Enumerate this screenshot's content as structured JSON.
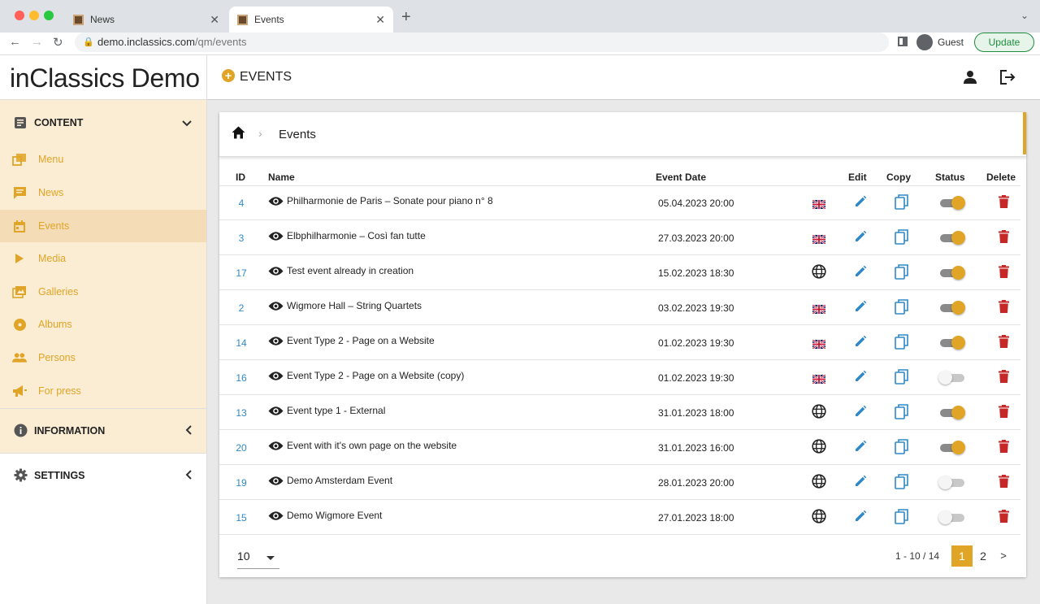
{
  "browser": {
    "tabs": [
      {
        "title": "News",
        "active": false
      },
      {
        "title": "Events",
        "active": true
      }
    ],
    "url_host": "demo.inclassics.com",
    "url_path": "/qm/events",
    "profile": "Guest",
    "update_label": "Update"
  },
  "sidebar": {
    "brand": "inClassics Demo",
    "content_label": "CONTENT",
    "items": [
      {
        "label": "Menu",
        "icon": "menu-stack-icon"
      },
      {
        "label": "News",
        "icon": "chat-icon"
      },
      {
        "label": "Events",
        "icon": "calendar-icon"
      },
      {
        "label": "Media",
        "icon": "play-icon"
      },
      {
        "label": "Galleries",
        "icon": "gallery-icon"
      },
      {
        "label": "Albums",
        "icon": "album-icon"
      },
      {
        "label": "Persons",
        "icon": "people-icon"
      },
      {
        "label": "For press",
        "icon": "megaphone-icon"
      }
    ],
    "active_item": "Events",
    "information_label": "INFORMATION",
    "settings_label": "SETTINGS"
  },
  "header": {
    "title": "EVENTS"
  },
  "breadcrumb": {
    "current": "Events"
  },
  "table": {
    "columns": [
      "ID",
      "Name",
      "Event Date",
      "Edit",
      "Copy",
      "Status",
      "Delete"
    ],
    "rows": [
      {
        "id": "4",
        "name": "Philharmonie de Paris – Sonate pour piano n° 8",
        "date": "05.04.2023 20:00",
        "lang": "uk-flag",
        "status": true
      },
      {
        "id": "3",
        "name": "Elbphilharmonie – Così fan tutte",
        "date": "27.03.2023 20:00",
        "lang": "uk-flag",
        "status": true
      },
      {
        "id": "17",
        "name": "Test event already in creation",
        "date": "15.02.2023 18:30",
        "lang": "globe",
        "status": true
      },
      {
        "id": "2",
        "name": "Wigmore Hall – String Quartets",
        "date": "03.02.2023 19:30",
        "lang": "uk-flag",
        "status": true
      },
      {
        "id": "14",
        "name": "Event Type 2 - Page on a Website",
        "date": "01.02.2023 19:30",
        "lang": "uk-flag",
        "status": true
      },
      {
        "id": "16",
        "name": "Event Type 2 - Page on a Website (copy)",
        "date": "01.02.2023 19:30",
        "lang": "uk-flag",
        "status": false
      },
      {
        "id": "13",
        "name": "Event type 1 - External",
        "date": "31.01.2023 18:00",
        "lang": "globe",
        "status": true
      },
      {
        "id": "20",
        "name": "Event with it's own page on the website",
        "date": "31.01.2023 16:00",
        "lang": "globe",
        "status": true
      },
      {
        "id": "19",
        "name": "Demo Amsterdam Event",
        "date": "28.01.2023 20:00",
        "lang": "globe",
        "status": false
      },
      {
        "id": "15",
        "name": "Demo Wigmore Event",
        "date": "27.01.2023 18:00",
        "lang": "globe",
        "status": false
      }
    ]
  },
  "pagination": {
    "page_size": "10",
    "range": "1 - 10 / 14",
    "pages": [
      "1",
      "2"
    ],
    "current": "1",
    "next": ">"
  },
  "colors": {
    "accent": "#e0a526",
    "link": "#2f88c8",
    "edit": "#2f88c8",
    "delete": "#c62828",
    "sidebar_bg": "#fbecd4"
  }
}
